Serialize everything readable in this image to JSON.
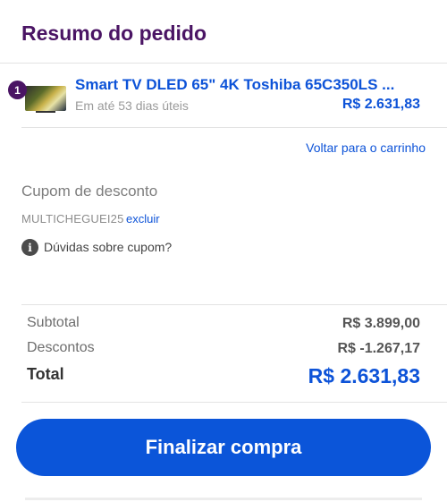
{
  "page_title": "Resumo do pedido",
  "cart_item": {
    "quantity": "1",
    "name": "Smart TV DLED 65\" 4K Toshiba 65C350LS ...",
    "delivery": "Em até 53 dias úteis",
    "price": "R$ 2.631,83"
  },
  "back_to_cart_label": "Voltar para o carrinho",
  "coupon": {
    "title": "Cupom de desconto",
    "code": "MULTICHEGUEI25",
    "remove_label": "excluir",
    "help_icon_glyph": "i",
    "help_label": "Dúvidas sobre cupom?"
  },
  "summary": {
    "subtotal_label": "Subtotal",
    "subtotal_value": "R$ 3.899,00",
    "discount_label": "Descontos",
    "discount_value": "R$ -1.267,17",
    "total_label": "Total",
    "total_value": "R$ 2.631,83"
  },
  "checkout_label": "Finalizar compra",
  "colors": {
    "brand_purple": "#4a1464",
    "accent_blue": "#0b55d9"
  },
  "icons": {
    "help": "info-icon"
  }
}
